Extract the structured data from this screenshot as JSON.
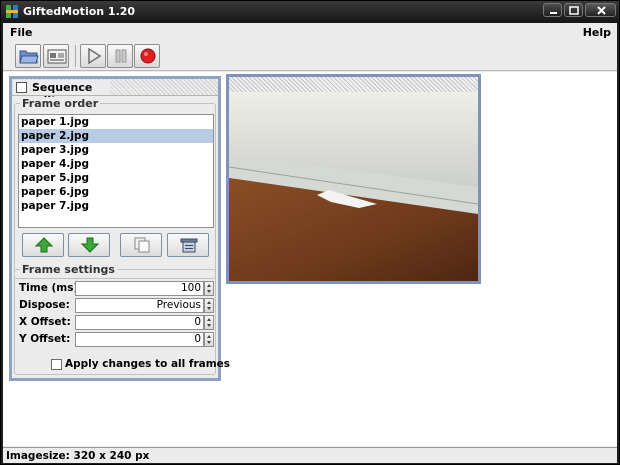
{
  "window": {
    "title": "GiftedMotion 1.20",
    "icon": "giftedmotion-app-icon"
  },
  "menu": {
    "file": "File",
    "help": "Help"
  },
  "toolbar": {
    "buttons": [
      "open-folder-icon",
      "export-icon",
      "play-icon",
      "pause-icon",
      "record-icon"
    ]
  },
  "sequence_editor": {
    "title": "Sequence editor",
    "frame_order_label": "Frame order",
    "frames": [
      "paper 1.jpg",
      "paper 2.jpg",
      "paper 3.jpg",
      "paper 4.jpg",
      "paper 5.jpg",
      "paper 6.jpg",
      "paper 7.jpg"
    ],
    "selected_frame": "paper 2.jpg",
    "frame_settings_label": "Frame settings",
    "time_label": "Time (ms):",
    "time_value": "100",
    "dispose_label": "Dispose:",
    "dispose_value": "Previous",
    "x_offset_label": "X Offset:",
    "x_offset_value": "0",
    "y_offset_label": "Y Offset:",
    "y_offset_value": "0",
    "apply_all_label": "Apply changes to all frames",
    "apply_all_checked": false
  },
  "status": {
    "text": "Imagesize: 320 x 240 px"
  },
  "colors": {
    "panel_border": "#8ea2c2",
    "selection": "#b7cbe4",
    "record_red": "#e02020",
    "move_arrow_green": "#3aa93a"
  }
}
